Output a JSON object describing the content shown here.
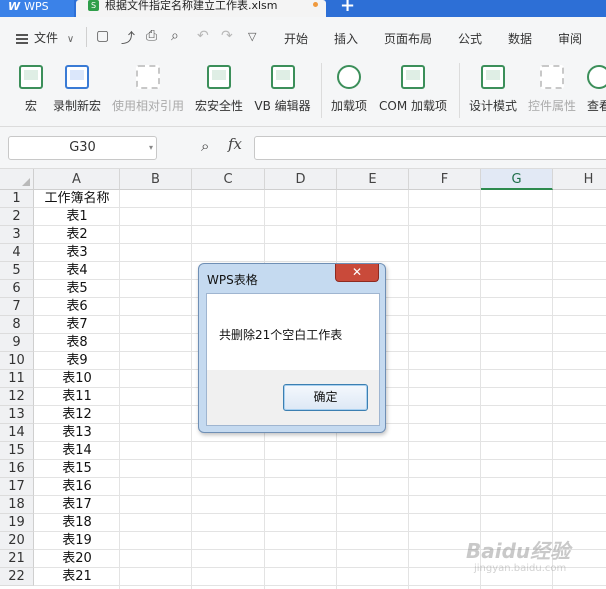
{
  "tabs": {
    "app_label": "WPS",
    "file_name": "根据文件指定名称建立工作表.xlsm",
    "add_symbol": "+"
  },
  "menu": {
    "file_label": "文件",
    "items": [
      "开始",
      "插入",
      "页面布局",
      "公式",
      "数据",
      "审阅"
    ]
  },
  "ribbon": {
    "buttons": [
      {
        "label": "宏",
        "enabled": true
      },
      {
        "label": "录制新宏",
        "enabled": true
      },
      {
        "label": "使用相对引用",
        "enabled": false
      },
      {
        "label": "宏安全性",
        "enabled": true
      },
      {
        "label": "VB 编辑器",
        "enabled": true
      },
      {
        "label": "加载项",
        "enabled": true
      },
      {
        "label": "COM 加载项",
        "enabled": true
      },
      {
        "label": "设计模式",
        "enabled": true
      },
      {
        "label": "控件属性",
        "enabled": false
      },
      {
        "label": "查看",
        "enabled": true
      }
    ]
  },
  "formula_bar": {
    "name_box": "G30",
    "fx_label": "fx",
    "formula_value": ""
  },
  "sheet": {
    "columns": [
      "A",
      "B",
      "C",
      "D",
      "E",
      "F",
      "G",
      "H"
    ],
    "selected_column": "G",
    "rows": [
      "1",
      "2",
      "3",
      "4",
      "5",
      "6",
      "7",
      "8",
      "9",
      "10",
      "11",
      "12",
      "13",
      "14",
      "15",
      "16",
      "17",
      "18",
      "19",
      "20",
      "21",
      "22"
    ],
    "column_a_values": [
      "工作簿名称",
      "表1",
      "表2",
      "表3",
      "表4",
      "表5",
      "表6",
      "表7",
      "表8",
      "表9",
      "表10",
      "表11",
      "表12",
      "表13",
      "表14",
      "表15",
      "表16",
      "表17",
      "表18",
      "表19",
      "表20",
      "表21"
    ]
  },
  "dialog": {
    "title": "WPS表格",
    "close_symbol": "✕",
    "message": "共删除21个空白工作表",
    "ok_label": "确定"
  },
  "watermark": {
    "text": "Baidu经验",
    "sub": "jingyan.baidu.com"
  }
}
